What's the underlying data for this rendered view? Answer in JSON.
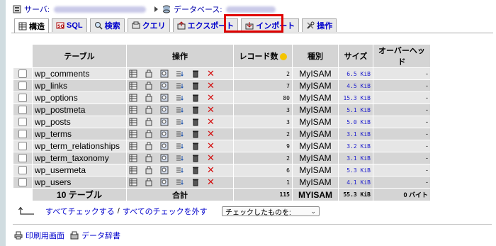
{
  "breadcrumb": {
    "server_label": "サーバ:",
    "database_label": "データベース:"
  },
  "tabs": [
    {
      "label": "構造",
      "icon": "structure-icon",
      "active": true
    },
    {
      "label": "SQL",
      "icon": "sql-icon",
      "active": false
    },
    {
      "label": "検索",
      "icon": "search-icon",
      "active": false
    },
    {
      "label": "クエリ",
      "icon": "query-icon",
      "active": false
    },
    {
      "label": "エクスポート",
      "icon": "export-icon",
      "active": false
    },
    {
      "label": "インポート",
      "icon": "import-icon",
      "active": false
    },
    {
      "label": "操作",
      "icon": "operations-icon",
      "active": false
    }
  ],
  "highlight_color": "#e00000",
  "table": {
    "headers": {
      "table": "テーブル",
      "ops": "操作",
      "records": "レコード数",
      "type": "種別",
      "size": "サイズ",
      "overhead": "オーバーヘッド"
    },
    "rows": [
      {
        "name": "wp_comments",
        "records": "2",
        "type": "MyISAM",
        "size": "6.5 KiB",
        "overhead": "-"
      },
      {
        "name": "wp_links",
        "records": "7",
        "type": "MyISAM",
        "size": "4.5 KiB",
        "overhead": "-"
      },
      {
        "name": "wp_options",
        "records": "80",
        "type": "MyISAM",
        "size": "15.3 KiB",
        "overhead": "-"
      },
      {
        "name": "wp_postmeta",
        "records": "3",
        "type": "MyISAM",
        "size": "5.1 KiB",
        "overhead": "-"
      },
      {
        "name": "wp_posts",
        "records": "3",
        "type": "MyISAM",
        "size": "5.0 KiB",
        "overhead": "-"
      },
      {
        "name": "wp_terms",
        "records": "2",
        "type": "MyISAM",
        "size": "3.1 KiB",
        "overhead": "-"
      },
      {
        "name": "wp_term_relationships",
        "records": "9",
        "type": "MyISAM",
        "size": "3.2 KiB",
        "overhead": "-"
      },
      {
        "name": "wp_term_taxonomy",
        "records": "2",
        "type": "MyISAM",
        "size": "3.1 KiB",
        "overhead": "-"
      },
      {
        "name": "wp_usermeta",
        "records": "6",
        "type": "MyISAM",
        "size": "5.3 KiB",
        "overhead": "-"
      },
      {
        "name": "wp_users",
        "records": "1",
        "type": "MyISAM",
        "size": "4.1 KiB",
        "overhead": "-"
      }
    ],
    "row_icons": [
      "browse-icon",
      "structure-icon",
      "search-icon",
      "insert-icon",
      "empty-icon",
      "drop-icon"
    ],
    "total": {
      "label": "10 テーブル",
      "sum_label": "合計",
      "records": "115",
      "type": "MYISAM",
      "size": "55.3 KiB",
      "overhead": "0 バイト"
    }
  },
  "bulk": {
    "check_all": "すべてチェックする",
    "separator": "/",
    "uncheck_all": "すべてのチェックを外す",
    "select_value": "チェックしたものを:"
  },
  "footer": {
    "print_label": "印刷用画面",
    "dictionary_label": "データ辞書"
  }
}
